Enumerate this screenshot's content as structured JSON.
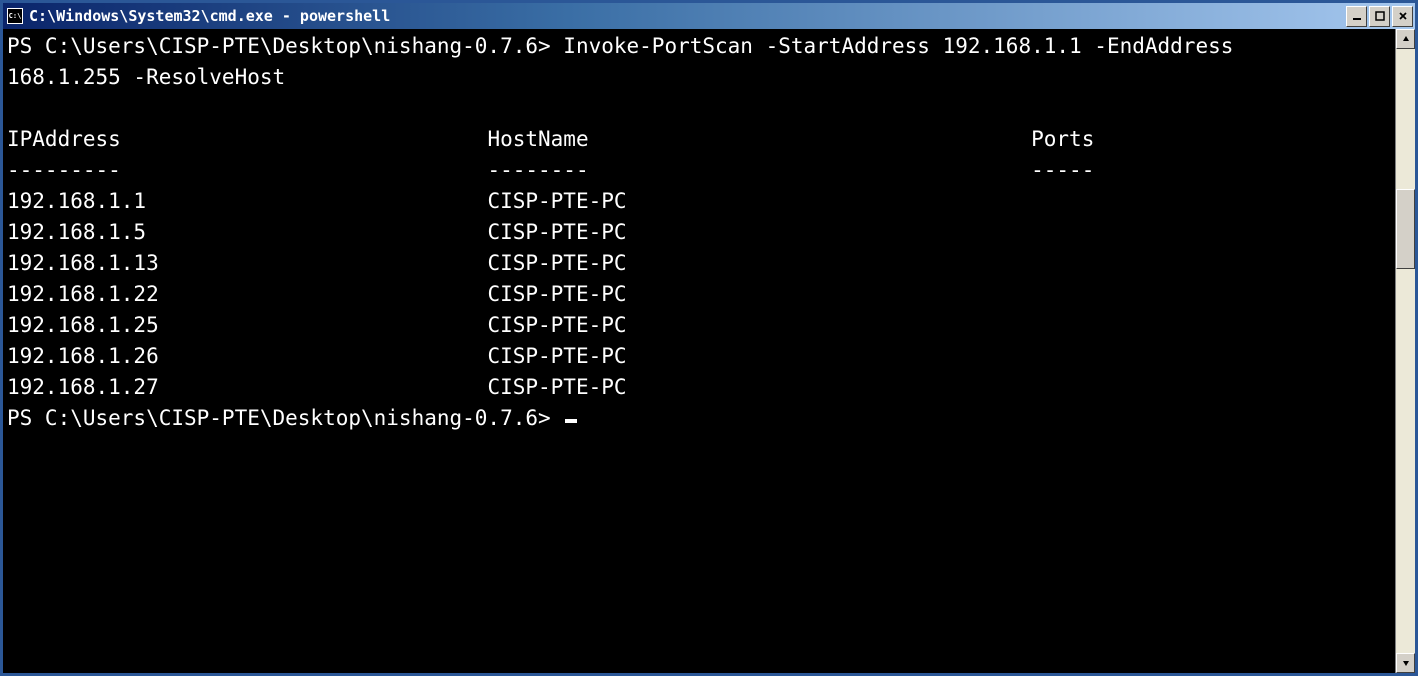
{
  "window": {
    "title": "C:\\Windows\\System32\\cmd.exe - powershell"
  },
  "terminal": {
    "prompt": "PS C:\\Users\\CISP-PTE\\Desktop\\nishang-0.7.6>",
    "command_line1": "PS C:\\Users\\CISP-PTE\\Desktop\\nishang-0.7.6> Invoke-PortScan -StartAddress 192.168.1.1 -EndAddress",
    "command_line2": "168.1.255 -ResolveHost",
    "columns": {
      "ip": "IPAddress",
      "host": "HostName",
      "ports": "Ports",
      "ip_sep": "---------",
      "host_sep": "--------",
      "ports_sep": "-----"
    },
    "rows": [
      {
        "ip": "192.168.1.1",
        "host": "CISP-PTE-PC"
      },
      {
        "ip": "192.168.1.5",
        "host": "CISP-PTE-PC"
      },
      {
        "ip": "192.168.1.13",
        "host": "CISP-PTE-PC"
      },
      {
        "ip": "192.168.1.22",
        "host": "CISP-PTE-PC"
      },
      {
        "ip": "192.168.1.25",
        "host": "CISP-PTE-PC"
      },
      {
        "ip": "192.168.1.26",
        "host": "CISP-PTE-PC"
      },
      {
        "ip": "192.168.1.27",
        "host": "CISP-PTE-PC"
      }
    ],
    "prompt2": "PS C:\\Users\\CISP-PTE\\Desktop\\nishang-0.7.6> "
  }
}
